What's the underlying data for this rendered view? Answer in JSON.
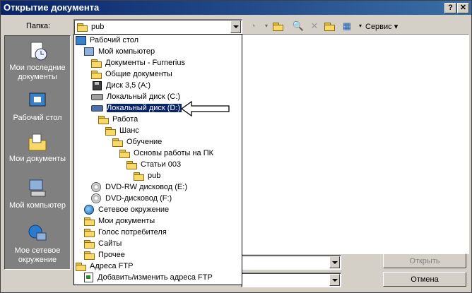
{
  "window": {
    "title": "Открытие документа",
    "help_btn": "?",
    "close_btn": "✕"
  },
  "folder_bar": {
    "label": "Папка:",
    "current": "pub"
  },
  "toolbar": {
    "service_label": "Сервис"
  },
  "places": [
    {
      "label": "Мои последние документы"
    },
    {
      "label": "Рабочий стол"
    },
    {
      "label": "Мои документы"
    },
    {
      "label": "Мой компьютер"
    },
    {
      "label": "Мое сетевое окружение"
    }
  ],
  "dropdown_items": [
    {
      "label": "Рабочий стол",
      "icon": "desktop-icon"
    },
    {
      "label": "Мой компьютер",
      "icon": "computer-icon"
    },
    {
      "label": "Документы - Furnerius",
      "icon": "folder-icon"
    },
    {
      "label": "Общие документы",
      "icon": "folder-icon"
    },
    {
      "label": "Диск 3,5 (A:)",
      "icon": "floppy-icon"
    },
    {
      "label": "Локальный диск (C:)",
      "icon": "drive-icon"
    },
    {
      "label": "Локальный диск (D:)",
      "icon": "drive-icon",
      "selected": true
    },
    {
      "label": "Работа",
      "icon": "folder-icon"
    },
    {
      "label": "Шанс",
      "icon": "folder-icon"
    },
    {
      "label": "Обучение",
      "icon": "folder-icon"
    },
    {
      "label": "Основы работы на ПК",
      "icon": "folder-icon"
    },
    {
      "label": "Статьи 003",
      "icon": "folder-icon"
    },
    {
      "label": "pub",
      "icon": "folder-icon"
    },
    {
      "label": "DVD-RW дисковод (E:)",
      "icon": "cd-icon"
    },
    {
      "label": "DVD-дисковод (F:)",
      "icon": "cd-icon"
    },
    {
      "label": "Сетевое окружение",
      "icon": "network-icon"
    },
    {
      "label": "Мои документы",
      "icon": "folder-icon"
    },
    {
      "label": "Голос потребителя",
      "icon": "folder-icon"
    },
    {
      "label": "Сайты",
      "icon": "folder-icon"
    },
    {
      "label": "Прочее",
      "icon": "folder-icon"
    },
    {
      "label": "Адреса FTP",
      "icon": "folder-icon"
    },
    {
      "label": "Добавить/изменить адреса FTP",
      "icon": "ftp-icon"
    }
  ],
  "buttons": {
    "open": "Открыть",
    "cancel": "Отмена"
  },
  "colors": {
    "title_bar": "#0a246a",
    "selection": "#0a246a",
    "dialog_bg": "#d4d0c8"
  }
}
